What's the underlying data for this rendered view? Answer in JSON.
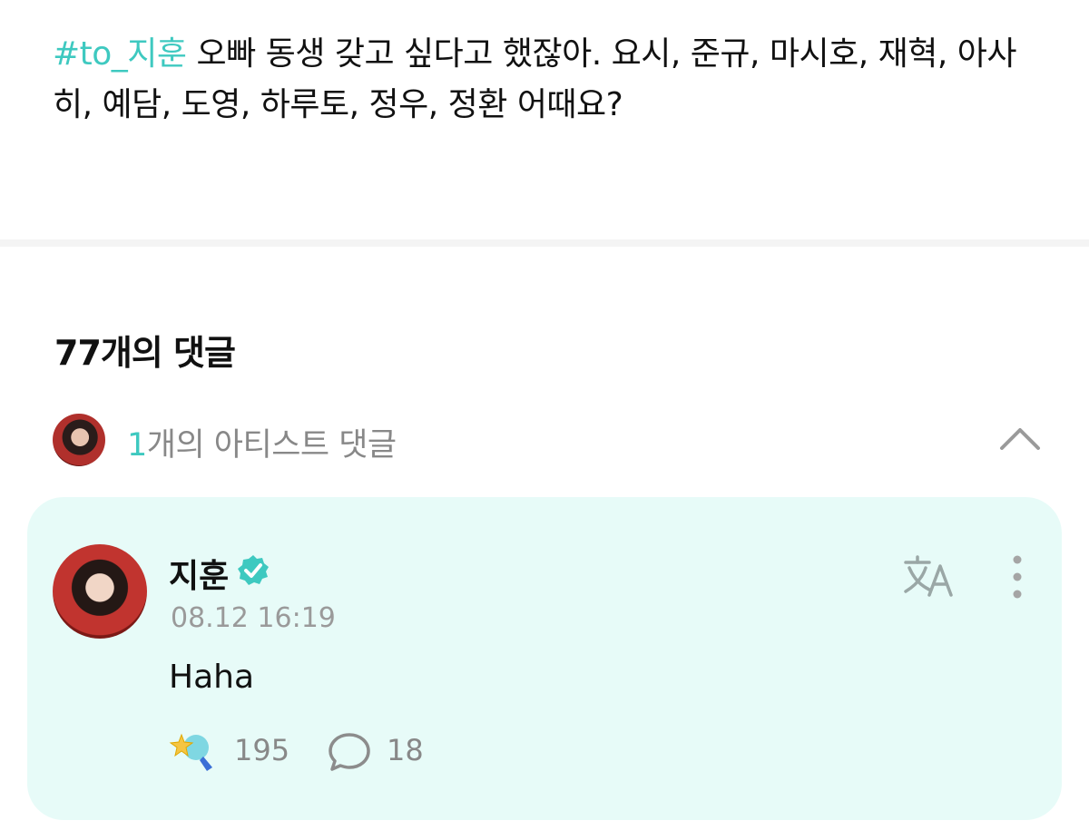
{
  "post": {
    "hashtag": "#to_지훈",
    "text": " 오빠 동생 갖고 싶다고 했잖아.  요시, 준규, 마시호, 재혁, 아사히, 예담, 도영, 하루토, 정우, 정환 어때요?"
  },
  "comments": {
    "count_label": "77개의 댓글"
  },
  "artist_comments": {
    "count": "1",
    "label": "개의 아티스트 댓글",
    "toggle_icon": "chevron-up-icon"
  },
  "artist_comment": {
    "author": "지훈",
    "verified_icon": "verified-badge-icon",
    "timestamp": "08.12 16:19",
    "text": "Haha",
    "likes": "195",
    "replies": "18",
    "translate_icon": "translate-icon",
    "more_icon": "more-vertical-icon",
    "reaction_icon": "star-lightstick-icon",
    "reply_icon": "speech-bubble-icon"
  },
  "colors": {
    "accent": "#3ec9c0",
    "card_bg": "#e7fbf8",
    "muted_text": "#888888"
  }
}
